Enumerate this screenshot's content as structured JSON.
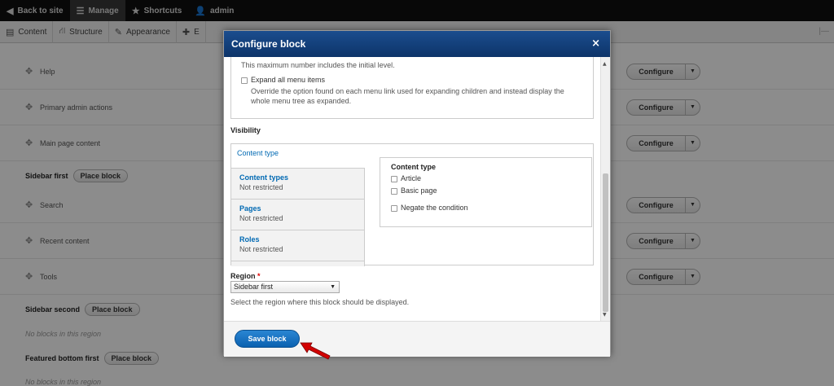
{
  "toolbar": {
    "back": "Back to site",
    "manage": "Manage",
    "shortcuts": "Shortcuts",
    "user": "admin"
  },
  "tray": {
    "items": [
      "Content",
      "Structure",
      "Appearance",
      "E"
    ]
  },
  "page": {
    "rows": [
      {
        "label": "Help",
        "button": "Configure"
      },
      {
        "label": "Primary admin actions",
        "button": "Configure"
      },
      {
        "label": "Main page content",
        "button": "Configure"
      },
      {
        "label": "Search",
        "button": "Configure"
      },
      {
        "label": "Recent content",
        "button": "Configure"
      },
      {
        "label": "Tools",
        "button": "Configure"
      }
    ],
    "regions": [
      {
        "name": "Sidebar first",
        "button": "Place block"
      },
      {
        "name": "Sidebar second",
        "button": "Place block"
      },
      {
        "name": "Featured bottom first",
        "button": "Place block"
      }
    ],
    "no_blocks": "No blocks in this region"
  },
  "dialog": {
    "title": "Configure block",
    "close": "×",
    "max_note": "This maximum number includes the initial level.",
    "expand_label": "Expand all menu items",
    "expand_desc1": "Override the option found on each menu link used for expanding children and instead display the",
    "expand_desc2": "whole menu tree as expanded.",
    "visibility": "Visibility",
    "active_tab": "Content type",
    "tabs": [
      {
        "name": "Content types",
        "summary": "Not restricted"
      },
      {
        "name": "Pages",
        "summary": "Not restricted"
      },
      {
        "name": "Roles",
        "summary": "Not restricted"
      }
    ],
    "panel": {
      "title": "Content type",
      "options": [
        "Article",
        "Basic page"
      ],
      "negate": "Negate the condition"
    },
    "region_label": "Region",
    "region_required": "*",
    "region_value": "Sidebar first",
    "region_help": "Select the region where this block should be displayed.",
    "save": "Save block"
  },
  "colors": {
    "dialog_title_bg": "#1b4d8e",
    "save_button": "#0b61b0",
    "link_blue": "#0069b3",
    "required_red": "#e00000",
    "arrow_red": "#d20000"
  }
}
